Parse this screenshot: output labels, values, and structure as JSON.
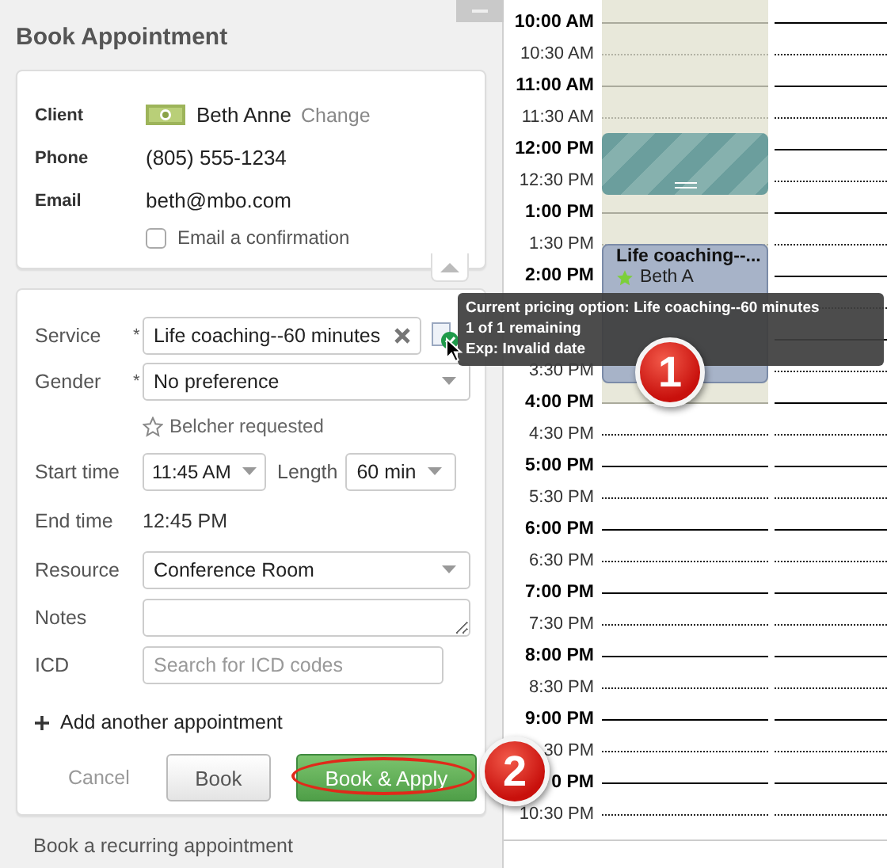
{
  "panel": {
    "title": "Book Appointment"
  },
  "client": {
    "fields": [
      {
        "label": "Client",
        "value": "Beth Anne",
        "link": "Change",
        "kind": "client"
      },
      {
        "label": "Phone",
        "value": "(805) 555-1234",
        "kind": "text"
      },
      {
        "label": "Email",
        "value": "beth@mbo.com",
        "kind": "text"
      }
    ],
    "email_confirmation": {
      "label": "Email a confirmation",
      "checked": false
    }
  },
  "form": {
    "required_mark": "*",
    "service": {
      "label": "Service",
      "required": true,
      "value": "Life coaching--60 minutes"
    },
    "gender": {
      "label": "Gender",
      "required": true,
      "value": "No preference"
    },
    "staff_request": "Belcher requested",
    "start_time": {
      "label": "Start time",
      "value": "11:45 AM"
    },
    "length": {
      "label": "Length",
      "value": "60 min"
    },
    "end_time": {
      "label": "End time",
      "value": "12:45 PM"
    },
    "resource": {
      "label": "Resource",
      "value": "Conference Room"
    },
    "notes": {
      "label": "Notes"
    },
    "icd": {
      "label": "ICD",
      "placeholder": "Search for ICD codes"
    },
    "add_another": "Add another appointment",
    "buttons": [
      {
        "label": "Cancel",
        "kind": "link",
        "highlighted": false
      },
      {
        "label": "Book",
        "kind": "default",
        "highlighted": false
      },
      {
        "label": "Book & Apply",
        "kind": "primary",
        "highlighted": true
      }
    ]
  },
  "recurring_link": "Book a recurring appointment",
  "tooltip": {
    "lines": [
      "Current pricing option: Life coaching--60 minutes",
      "1 of 1 remaining",
      "Exp: Invalid date"
    ]
  },
  "calendar": {
    "slots": [
      {
        "label": "10:00 AM",
        "kind": "hour"
      },
      {
        "label": "10:30 AM",
        "kind": "half"
      },
      {
        "label": "11:00 AM",
        "kind": "hour"
      },
      {
        "label": "11:30 AM",
        "kind": "half"
      },
      {
        "label": "12:00 PM",
        "kind": "hour"
      },
      {
        "label": "12:30 PM",
        "kind": "half"
      },
      {
        "label": "1:00 PM",
        "kind": "hour"
      },
      {
        "label": "1:30 PM",
        "kind": "half"
      },
      {
        "label": "2:00 PM",
        "kind": "hour"
      },
      {
        "kind": "half"
      },
      {
        "kind": "hour"
      },
      {
        "label": "3:30 PM",
        "kind": "half"
      },
      {
        "label": "4:00 PM",
        "kind": "hour"
      },
      {
        "label": "4:30 PM",
        "kind": "half"
      },
      {
        "label": "5:00 PM",
        "kind": "hour"
      },
      {
        "label": "5:30 PM",
        "kind": "half"
      },
      {
        "label": "6:00 PM",
        "kind": "hour"
      },
      {
        "label": "6:30 PM",
        "kind": "half"
      },
      {
        "label": "7:00 PM",
        "kind": "hour"
      },
      {
        "label": "7:30 PM",
        "kind": "half"
      },
      {
        "label": "8:00 PM",
        "kind": "hour"
      },
      {
        "label": "8:30 PM",
        "kind": "half"
      },
      {
        "label": "9:00 PM",
        "kind": "hour"
      },
      {
        "label": "30 PM",
        "kind": "half"
      },
      {
        "label": "0 PM",
        "kind": "hour"
      },
      {
        "label": "10:30 PM",
        "kind": "half"
      }
    ],
    "events": [
      {
        "kind": "blocked"
      },
      {
        "kind": "appointment",
        "title": "Life coaching--...",
        "client": "Beth A"
      }
    ]
  },
  "callouts": [
    "1",
    "2"
  ]
}
